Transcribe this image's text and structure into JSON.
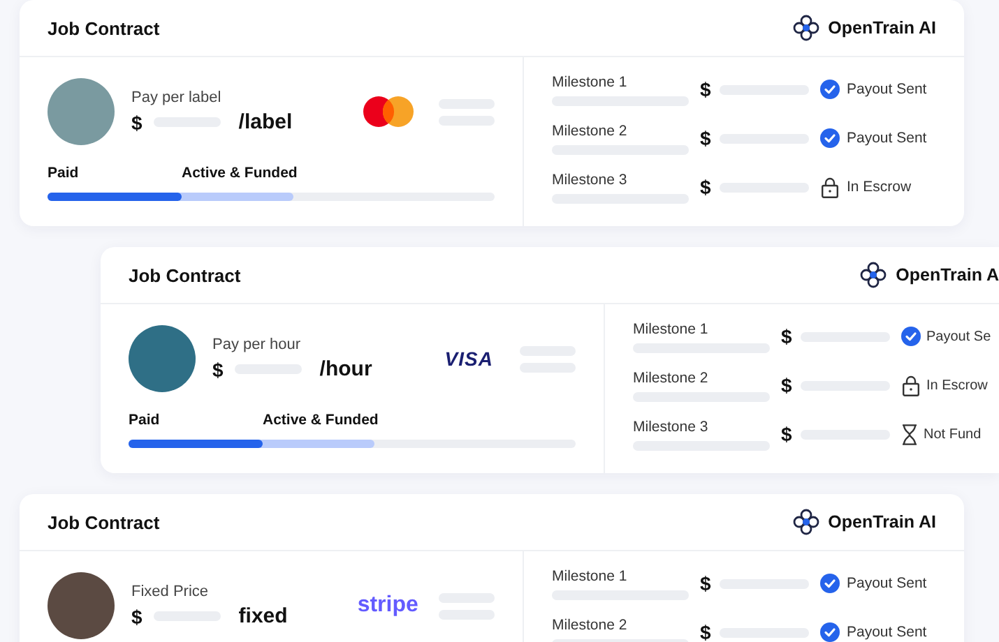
{
  "cards": [
    {
      "title": "Job Contract",
      "brand": "OpenTrain AI",
      "pay_label": "Pay per label",
      "unit": "/label",
      "currency": "$",
      "payment": {
        "kind": "mastercard"
      },
      "avatar": {
        "color": "#7a9aa0"
      },
      "progress": {
        "paid": {
          "label": "Paid",
          "level": 0.3
        },
        "funded": {
          "label": "Active & Funded",
          "level": 0.55
        }
      },
      "milestones": [
        {
          "label": "Milestone 1",
          "currency": "$",
          "status": {
            "kind": "sent",
            "text": "Payout Sent"
          }
        },
        {
          "label": "Milestone 2",
          "currency": "$",
          "status": {
            "kind": "sent",
            "text": "Payout Sent"
          }
        },
        {
          "label": "Milestone 3",
          "currency": "$",
          "status": {
            "kind": "escrow",
            "text": "In Escrow"
          }
        }
      ]
    },
    {
      "title": "Job Contract",
      "brand": "OpenTrain A",
      "pay_label": "Pay per hour",
      "unit": "/hour",
      "currency": "$",
      "payment": {
        "kind": "visa",
        "text": "VISA"
      },
      "avatar": {
        "color": "#2f6f86"
      },
      "progress": {
        "paid": {
          "label": "Paid",
          "level": 0.3
        },
        "funded": {
          "label": "Active & Funded",
          "level": 0.55
        }
      },
      "milestones": [
        {
          "label": "Milestone 1",
          "currency": "$",
          "status": {
            "kind": "sent",
            "text": "Payout Se"
          }
        },
        {
          "label": "Milestone 2",
          "currency": "$",
          "status": {
            "kind": "escrow",
            "text": "In Escrow"
          }
        },
        {
          "label": "Milestone 3",
          "currency": "$",
          "status": {
            "kind": "not_funded",
            "text": "Not Fund"
          }
        }
      ]
    },
    {
      "title": "Job Contract",
      "brand": "OpenTrain AI",
      "pay_label": "Fixed Price",
      "unit": "fixed",
      "currency": "$",
      "payment": {
        "kind": "stripe",
        "text": "stripe"
      },
      "avatar": {
        "color": "#5b4a42"
      },
      "milestones": [
        {
          "label": "Milestone 1",
          "currency": "$",
          "status": {
            "kind": "sent",
            "text": "Payout Sent"
          }
        },
        {
          "label": "Milestone 2",
          "currency": "$",
          "status": {
            "kind": "sent",
            "text": "Payout Sent"
          }
        }
      ]
    }
  ]
}
